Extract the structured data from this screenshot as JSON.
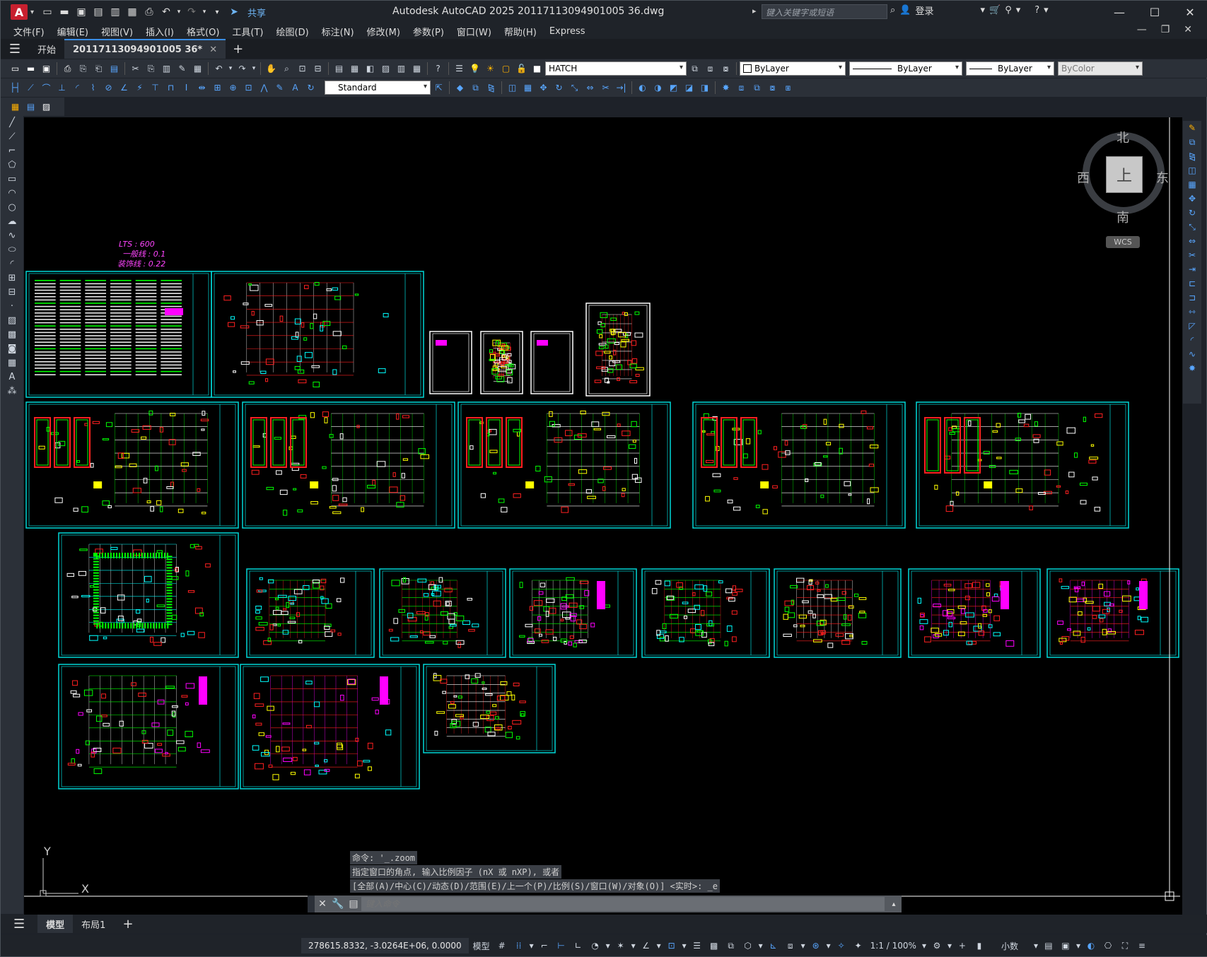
{
  "app": {
    "logo": "A",
    "title": "Autodesk AutoCAD 2025   20117113094901005 36.dwg",
    "share": "共享",
    "search_placeholder": "键入关键字或短语",
    "login": "登录"
  },
  "menu": [
    "文件(F)",
    "编辑(E)",
    "视图(V)",
    "插入(I)",
    "格式(O)",
    "工具(T)",
    "绘图(D)",
    "标注(N)",
    "修改(M)",
    "参数(P)",
    "窗口(W)",
    "帮助(H)",
    "Express"
  ],
  "tabs": {
    "start": "开始",
    "active": "20117113094901005 36*"
  },
  "toolbar": {
    "layer": "HATCH",
    "text_style": "Standard",
    "color": "ByLayer",
    "linetype": "ByLayer",
    "lineweight": "ByLayer",
    "plotstyle": "ByColor"
  },
  "viewcube": {
    "north": "北",
    "south": "南",
    "east": "东",
    "west": "西",
    "face": "上",
    "wcs": "WCS"
  },
  "drawing": {
    "lts_note": "LTS : 600",
    "note2": "一般线 : 0.1",
    "note3": "装饰线 : 0.22"
  },
  "ucs": {
    "y": "Y",
    "x": "X"
  },
  "command": {
    "history": [
      "命令: '_.zoom",
      "指定窗口的角点, 输入比例因子 (nX 或 nXP), 或者",
      "[全部(A)/中心(C)/动态(D)/范围(E)/上一个(P)/比例(S)/窗口(W)/对象(O)] <实时>: _e"
    ],
    "placeholder": "键入命令"
  },
  "layout_tabs": {
    "model": "模型",
    "layout1": "布局1"
  },
  "status": {
    "coords": "278615.8332, -3.0264E+06, 0.0000",
    "space": "模型",
    "scale": "1:1 / 100%",
    "units": "小数"
  }
}
